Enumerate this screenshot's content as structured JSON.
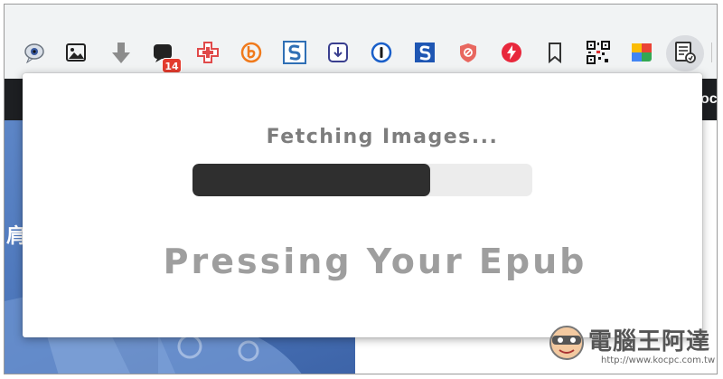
{
  "toolbar": {
    "extensions": [
      {
        "icon": "speech-bubble-eye-icon"
      },
      {
        "icon": "image-icon"
      },
      {
        "icon": "download-arrow-icon"
      },
      {
        "icon": "chat-badge-icon",
        "badge": "14"
      },
      {
        "icon": "medical-cross-icon"
      },
      {
        "icon": "b-circle-icon"
      },
      {
        "icon": "s-logo-icon"
      },
      {
        "icon": "download-box-icon"
      },
      {
        "icon": "one-password-icon"
      },
      {
        "icon": "s-square-icon"
      },
      {
        "icon": "shield-block-icon"
      },
      {
        "icon": "lightning-icon"
      },
      {
        "icon": "bookmark-icon"
      },
      {
        "icon": "qr-code-icon"
      },
      {
        "icon": "color-palette-icon"
      },
      {
        "icon": "epub-press-icon"
      }
    ]
  },
  "page": {
    "header_text": "ock",
    "art_char": "肩"
  },
  "popup": {
    "status": "Fetching Images...",
    "progress": 0.7,
    "title": "Pressing Your Epub"
  },
  "watermark": {
    "name": "電腦王阿達",
    "url": "http://www.kocpc.com.tw"
  },
  "colors": {
    "progress_fill": "#2f2f2f",
    "progress_track": "#ececec",
    "page_header": "#1d1f22",
    "art_blue": "#4a74b9"
  }
}
